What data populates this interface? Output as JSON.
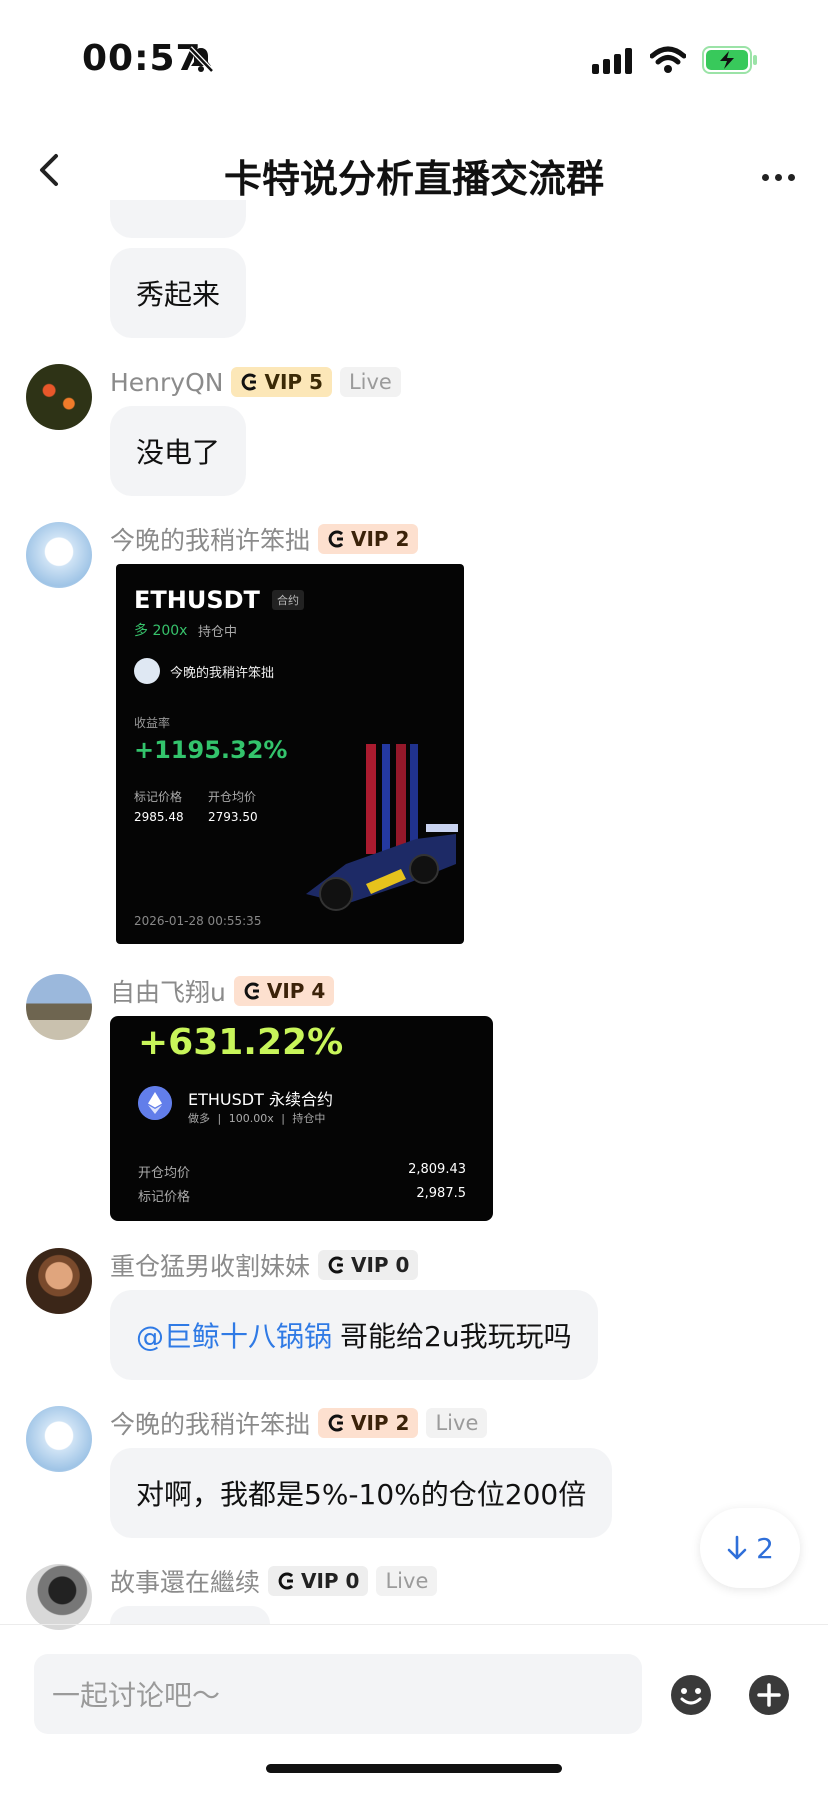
{
  "status": {
    "time": "00:57"
  },
  "header": {
    "title": "卡特说分析直播交流群"
  },
  "messages": [
    {
      "text": "秀起来"
    },
    {
      "name": "HenryQN",
      "vip": "VIP 5",
      "live": "Live",
      "text": "没电了"
    },
    {
      "name": "今晚的我稍许笨拙",
      "vip": "VIP 2",
      "card": {
        "pair": "ETHUSDT",
        "tag": "合约",
        "leverage": "多 200x",
        "holding": "持仓中",
        "user": "今晚的我稍许笨拙",
        "roi_label": "收益率",
        "roi": "+1195.32%",
        "mark_label": "标记价格",
        "open_label": "开仓均价",
        "mark_value": "2985.48",
        "open_value": "2793.50",
        "timestamp": "2026-01-28 00:55:35"
      }
    },
    {
      "name": "自由飞翔u",
      "vip": "VIP 4",
      "card": {
        "roi": "+631.22%",
        "pair": "ETHUSDT 永续合约",
        "sub": "做多 | 100.00x | 持仓中",
        "open_label": "开仓均价",
        "open_value": "2,809.43",
        "mark_label": "标记价格",
        "mark_value": "2,987.5"
      }
    },
    {
      "name": "重仓猛男收割妹妹",
      "vip": "VIP 0",
      "mention": "@巨鲸十八锅锅",
      "text": "哥能给2u我玩玩吗"
    },
    {
      "name": "今晚的我稍许笨拙",
      "vip": "VIP 2",
      "live": "Live",
      "text": "对啊，我都是5%-10%的仓位200倍"
    },
    {
      "name": "故事還在繼续",
      "vip": "VIP 0",
      "live": "Live"
    }
  ],
  "scroll": {
    "count": "2"
  },
  "input": {
    "placeholder": "一起讨论吧～"
  },
  "colors": {
    "accent_blue": "#2f7ae5",
    "profit_green": "#33c46c",
    "lime": "#c8f55a"
  }
}
